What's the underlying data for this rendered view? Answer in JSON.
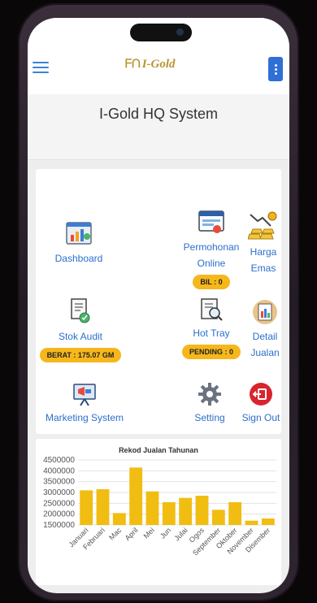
{
  "app": {
    "logo_text": "I-Gold",
    "logo_mark": "ᖴᑎ"
  },
  "page": {
    "title": "I-Gold HQ System"
  },
  "menu": [
    {
      "key": "dashboard",
      "label": "Dashboard",
      "icon": "dashboard-chart-icon"
    },
    {
      "key": "permohonan",
      "label_lines": [
        "Permohonan",
        "Online"
      ],
      "icon": "browser-window-icon",
      "badge": "BIL : 0"
    },
    {
      "key": "harga",
      "label_lines": [
        "Harga",
        "Emas"
      ],
      "icon": "gold-bars-icon"
    },
    {
      "key": "stok",
      "label": "Stok Audit",
      "icon": "audit-document-icon",
      "badge": "BERAT : 175.07 GM"
    },
    {
      "key": "hottray",
      "label": "Hot Tray",
      "icon": "inspect-document-icon",
      "badge": "PENDING : 0"
    },
    {
      "key": "detail",
      "label_lines": [
        "Detail",
        "Jualan"
      ],
      "icon": "sales-report-icon"
    },
    {
      "key": "marketing",
      "label": "Marketing System",
      "icon": "marketing-board-icon"
    },
    {
      "key": "setting",
      "label": "Setting",
      "icon": "gear-icon"
    },
    {
      "key": "signout",
      "label": "Sign Out",
      "icon": "sign-out-icon"
    }
  ],
  "colors": {
    "accent": "#2c6fcb",
    "badge": "#f6b71c",
    "bar": "#f1bd12",
    "signout": "#d9232e"
  },
  "chart_data": {
    "type": "bar",
    "title": "Rekod Jualan Tahunan",
    "categories": [
      "Januari",
      "Februari",
      "Mac",
      "April",
      "Mei",
      "Jun",
      "Julai",
      "Ogos",
      "September",
      "Oktober",
      "November",
      "Disember"
    ],
    "values": [
      3100000,
      3150000,
      2050000,
      4150000,
      3050000,
      2550000,
      2750000,
      2850000,
      2200000,
      2550000,
      1700000,
      1800000
    ],
    "yticks": [
      "4500000",
      "4000000",
      "3500000",
      "3000000",
      "2500000",
      "2000000",
      "1500000"
    ],
    "ylim": [
      1500000,
      4500000
    ],
    "grid": true
  }
}
